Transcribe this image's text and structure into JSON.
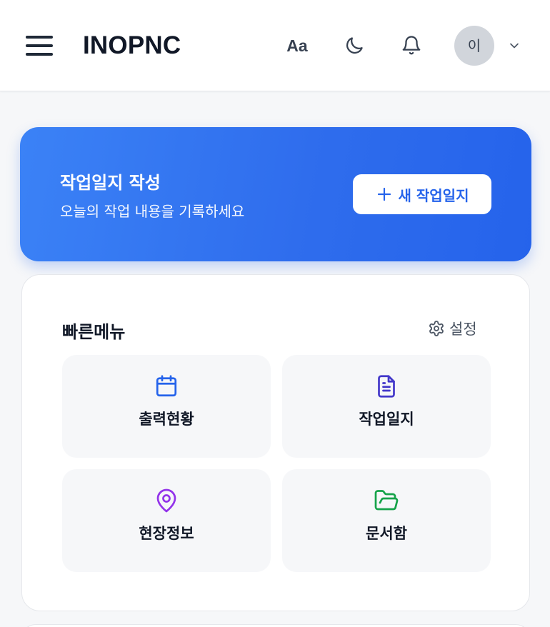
{
  "header": {
    "brand": "INOPNC",
    "font_size_label": "Aa",
    "theme_icon": "moon-icon",
    "notification_icon": "bell-icon",
    "avatar_initial": "이",
    "menu_icon": "hamburger-menu-icon",
    "avatar_menu_icon": "chevron-down-icon"
  },
  "hero": {
    "title": "작업일지 작성",
    "subtitle": "오늘의 작업 내용을 기록하세요",
    "button_label": "새 작업일지",
    "button_icon": "plus-icon",
    "gradient_start": "#3b82f6",
    "gradient_end": "#2563eb"
  },
  "quick_menu": {
    "title": "빠른메뉴",
    "settings_label": "설정",
    "settings_icon": "gear-icon",
    "items": [
      {
        "label": "출력현황",
        "icon": "calendar-icon",
        "color": "#2563eb"
      },
      {
        "label": "작업일지",
        "icon": "document-icon",
        "color": "#4338ca"
      },
      {
        "label": "현장정보",
        "icon": "map-pin-icon",
        "color": "#9333ea"
      },
      {
        "label": "문서함",
        "icon": "folder-open-icon",
        "color": "#16a34a"
      }
    ]
  }
}
